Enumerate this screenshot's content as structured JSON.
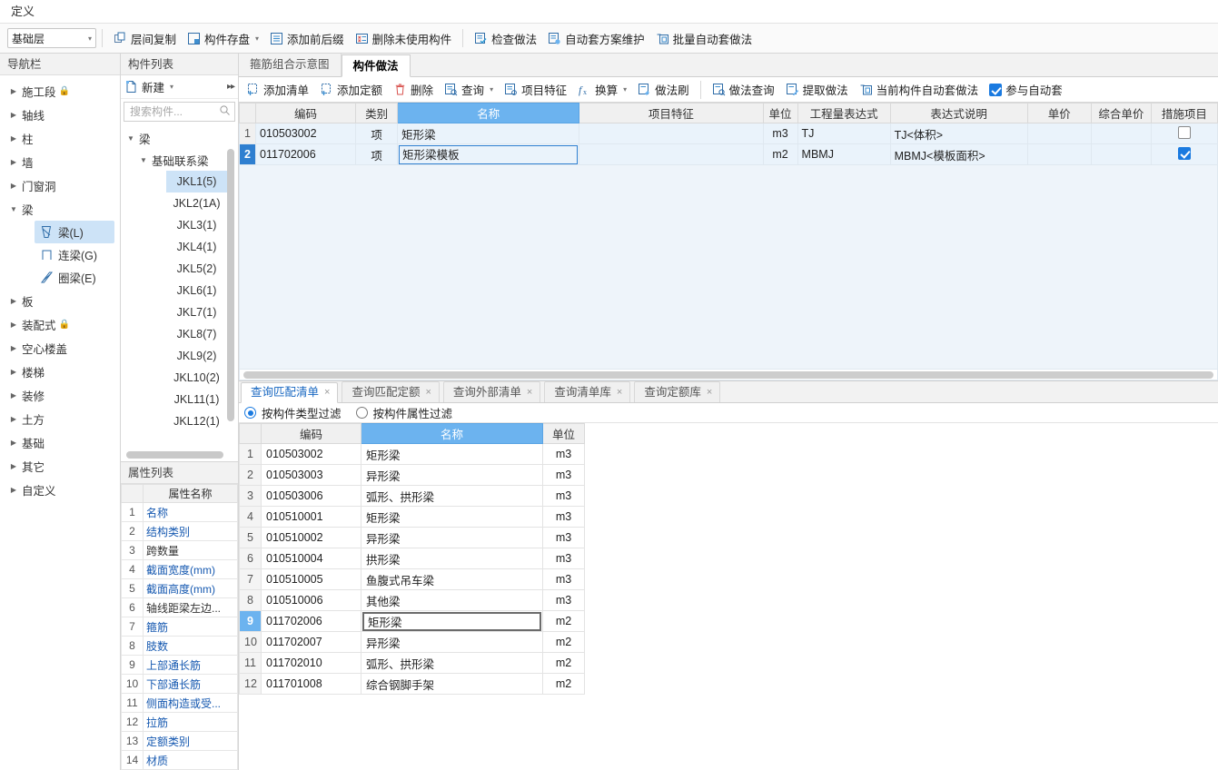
{
  "window": {
    "title": "定义"
  },
  "toolbar": {
    "floor_select": {
      "value": "基础层",
      "arrow": "▾"
    },
    "buttons": [
      {
        "label": "层间复制",
        "icon": "copy-between-floors-icon",
        "dropdown": false
      },
      {
        "label": "构件存盘",
        "icon": "save-component-icon",
        "dropdown": true
      },
      {
        "label": "添加前后缀",
        "icon": "add-prefix-suffix-icon",
        "dropdown": false
      },
      {
        "label": "删除未使用构件",
        "icon": "delete-unused-component-icon",
        "dropdown": false
      },
      {
        "label": "检查做法",
        "icon": "check-method-icon",
        "dropdown": false
      },
      {
        "label": "自动套方案维护",
        "icon": "auto-scheme-maintain-icon",
        "dropdown": false
      },
      {
        "label": "批量自动套做法",
        "icon": "batch-auto-method-icon",
        "dropdown": false
      }
    ]
  },
  "nav": {
    "title": "导航栏",
    "items": [
      {
        "label": "施工段",
        "locked": true,
        "expanded": false
      },
      {
        "label": "轴线",
        "locked": false,
        "expanded": false
      },
      {
        "label": "柱",
        "locked": false,
        "expanded": false
      },
      {
        "label": "墙",
        "locked": false,
        "expanded": false
      },
      {
        "label": "门窗洞",
        "locked": false,
        "expanded": false
      },
      {
        "label": "梁",
        "locked": false,
        "expanded": true
      },
      {
        "label": "板",
        "locked": false,
        "expanded": false
      },
      {
        "label": "装配式",
        "locked": true,
        "expanded": false
      },
      {
        "label": "空心楼盖",
        "locked": false,
        "expanded": false
      },
      {
        "label": "楼梯",
        "locked": false,
        "expanded": false
      },
      {
        "label": "装修",
        "locked": false,
        "expanded": false
      },
      {
        "label": "土方",
        "locked": false,
        "expanded": false
      },
      {
        "label": "基础",
        "locked": false,
        "expanded": false
      },
      {
        "label": "其它",
        "locked": false,
        "expanded": false
      },
      {
        "label": "自定义",
        "locked": false,
        "expanded": false
      }
    ],
    "beam_children": [
      {
        "label": "梁(L)",
        "icon": "beam-icon",
        "selected": true
      },
      {
        "label": "连梁(G)",
        "icon": "coupling-beam-icon",
        "selected": false
      },
      {
        "label": "圈梁(E)",
        "icon": "ring-beam-icon",
        "selected": false
      }
    ]
  },
  "component_list": {
    "title": "构件列表",
    "new_button": {
      "label": "新建",
      "icon": "new-file-icon",
      "arrow": "▾"
    },
    "expand_icon": "expand-arrows-icon",
    "search": {
      "placeholder": "搜索构件...",
      "value": "",
      "icon": "search-icon"
    },
    "tree": {
      "root": "梁",
      "group": "基础联系梁",
      "items": [
        {
          "label": "JKL1(5)",
          "selected": true
        },
        {
          "label": "JKL2(1A)",
          "selected": false
        },
        {
          "label": "JKL3(1)",
          "selected": false
        },
        {
          "label": "JKL4(1)",
          "selected": false
        },
        {
          "label": "JKL5(2)",
          "selected": false
        },
        {
          "label": "JKL6(1)",
          "selected": false
        },
        {
          "label": "JKL7(1)",
          "selected": false
        },
        {
          "label": "JKL8(7)",
          "selected": false
        },
        {
          "label": "JKL9(2)",
          "selected": false
        },
        {
          "label": "JKL10(2)",
          "selected": false
        },
        {
          "label": "JKL11(1)",
          "selected": false
        },
        {
          "label": "JKL12(1)",
          "selected": false
        }
      ]
    }
  },
  "property_list": {
    "title": "属性列表",
    "header": "属性名称",
    "rows": [
      {
        "n": "1",
        "name": "名称",
        "link": true
      },
      {
        "n": "2",
        "name": "结构类别",
        "link": true
      },
      {
        "n": "3",
        "name": "跨数量",
        "link": false
      },
      {
        "n": "4",
        "name": "截面宽度(mm)",
        "link": true
      },
      {
        "n": "5",
        "name": "截面高度(mm)",
        "link": true
      },
      {
        "n": "6",
        "name": "轴线距梁左边...",
        "link": false
      },
      {
        "n": "7",
        "name": "箍筋",
        "link": true
      },
      {
        "n": "8",
        "name": "肢数",
        "link": true
      },
      {
        "n": "9",
        "name": "上部通长筋",
        "link": true
      },
      {
        "n": "10",
        "name": "下部通长筋",
        "link": true
      },
      {
        "n": "11",
        "name": "侧面构造或受...",
        "link": true
      },
      {
        "n": "12",
        "name": "拉筋",
        "link": true
      },
      {
        "n": "13",
        "name": "定额类别",
        "link": true
      },
      {
        "n": "14",
        "name": "材质",
        "link": true
      }
    ]
  },
  "main": {
    "tabs": [
      {
        "label": "箍筋组合示意图",
        "active": false
      },
      {
        "label": "构件做法",
        "active": true
      }
    ],
    "subtoolbar": {
      "buttons": [
        {
          "label": "添加清单",
          "icon": "add-list-icon",
          "dropdown": false
        },
        {
          "label": "添加定额",
          "icon": "add-quota-icon",
          "dropdown": false
        },
        {
          "label": "删除",
          "icon": "delete-trash-icon",
          "dropdown": false
        },
        {
          "label": "查询",
          "icon": "query-icon",
          "dropdown": true
        },
        {
          "label": "项目特征",
          "icon": "project-feature-icon",
          "dropdown": false
        },
        {
          "label": "换算",
          "icon": "fx-convert-icon",
          "dropdown": true
        },
        {
          "label": "做法刷",
          "icon": "method-brush-icon",
          "dropdown": false
        },
        {
          "label": "做法查询",
          "icon": "method-query-icon",
          "dropdown": false
        },
        {
          "label": "提取做法",
          "icon": "extract-method-icon",
          "dropdown": false
        },
        {
          "label": "当前构件自动套做法",
          "icon": "current-component-auto-icon",
          "dropdown": false
        }
      ],
      "checkbox": {
        "label": "参与自动套",
        "checked": true
      }
    },
    "grid": {
      "columns": [
        {
          "key": "rn",
          "label": "",
          "highlight": false
        },
        {
          "key": "code",
          "label": "编码",
          "highlight": false
        },
        {
          "key": "type",
          "label": "类别",
          "highlight": false
        },
        {
          "key": "name",
          "label": "名称",
          "highlight": true
        },
        {
          "key": "feature",
          "label": "项目特征",
          "highlight": false
        },
        {
          "key": "unit",
          "label": "单位",
          "highlight": false
        },
        {
          "key": "expr",
          "label": "工程量表达式",
          "highlight": false
        },
        {
          "key": "exprdesc",
          "label": "表达式说明",
          "highlight": false
        },
        {
          "key": "price",
          "label": "单价",
          "highlight": false
        },
        {
          "key": "totalprice",
          "label": "综合单价",
          "highlight": false
        },
        {
          "key": "measure",
          "label": "措施项目",
          "highlight": false
        }
      ],
      "rows": [
        {
          "rn": "1",
          "code": "010503002",
          "type": "项",
          "name": "矩形梁",
          "feature": "",
          "unit": "m3",
          "expr": "TJ",
          "exprdesc": "TJ<体积>",
          "price": "",
          "totalprice": "",
          "measure_checked": false,
          "selected": false,
          "editing": false
        },
        {
          "rn": "2",
          "code": "011702006",
          "type": "项",
          "name": "矩形梁模板",
          "feature": "",
          "unit": "m2",
          "expr": "MBMJ",
          "exprdesc": "MBMJ<模板面积>",
          "price": "",
          "totalprice": "",
          "measure_checked": true,
          "selected": true,
          "editing": true
        }
      ]
    }
  },
  "bottom": {
    "tabs": [
      {
        "label": "查询匹配清单",
        "active": true,
        "close": "×"
      },
      {
        "label": "查询匹配定额",
        "active": false,
        "close": "×"
      },
      {
        "label": "查询外部清单",
        "active": false,
        "close": "×"
      },
      {
        "label": "查询清单库",
        "active": false,
        "close": "×"
      },
      {
        "label": "查询定额库",
        "active": false,
        "close": "×"
      }
    ],
    "filters": [
      {
        "label": "按构件类型过滤",
        "checked": true
      },
      {
        "label": "按构件属性过滤",
        "checked": false
      }
    ],
    "grid": {
      "columns": [
        {
          "key": "rn",
          "label": "",
          "highlight": false
        },
        {
          "key": "code",
          "label": "编码",
          "highlight": false
        },
        {
          "key": "name",
          "label": "名称",
          "highlight": true
        },
        {
          "key": "unit",
          "label": "单位",
          "highlight": false
        }
      ],
      "rows": [
        {
          "rn": "1",
          "code": "010503002",
          "name": "矩形梁",
          "unit": "m3",
          "selected": false,
          "editing": false
        },
        {
          "rn": "2",
          "code": "010503003",
          "name": "异形梁",
          "unit": "m3",
          "selected": false,
          "editing": false
        },
        {
          "rn": "3",
          "code": "010503006",
          "name": "弧形、拱形梁",
          "unit": "m3",
          "selected": false,
          "editing": false
        },
        {
          "rn": "4",
          "code": "010510001",
          "name": "矩形梁",
          "unit": "m3",
          "selected": false,
          "editing": false
        },
        {
          "rn": "5",
          "code": "010510002",
          "name": "异形梁",
          "unit": "m3",
          "selected": false,
          "editing": false
        },
        {
          "rn": "6",
          "code": "010510004",
          "name": "拱形梁",
          "unit": "m3",
          "selected": false,
          "editing": false
        },
        {
          "rn": "7",
          "code": "010510005",
          "name": "鱼腹式吊车梁",
          "unit": "m3",
          "selected": false,
          "editing": false
        },
        {
          "rn": "8",
          "code": "010510006",
          "name": "其他梁",
          "unit": "m3",
          "selected": false,
          "editing": false
        },
        {
          "rn": "9",
          "code": "011702006",
          "name": "矩形梁",
          "unit": "m2",
          "selected": true,
          "editing": true
        },
        {
          "rn": "10",
          "code": "011702007",
          "name": "异形梁",
          "unit": "m2",
          "selected": false,
          "editing": false
        },
        {
          "rn": "11",
          "code": "011702010",
          "name": "弧形、拱形梁",
          "unit": "m2",
          "selected": false,
          "editing": false
        },
        {
          "rn": "12",
          "code": "011701008",
          "name": "综合钢脚手架",
          "unit": "m2",
          "selected": false,
          "editing": false
        }
      ]
    }
  },
  "colors": {
    "accent_blue": "#1a7ae0",
    "header_highlight": "#6cb3ef",
    "selection": "#cde3f7",
    "link": "#1558b0"
  }
}
